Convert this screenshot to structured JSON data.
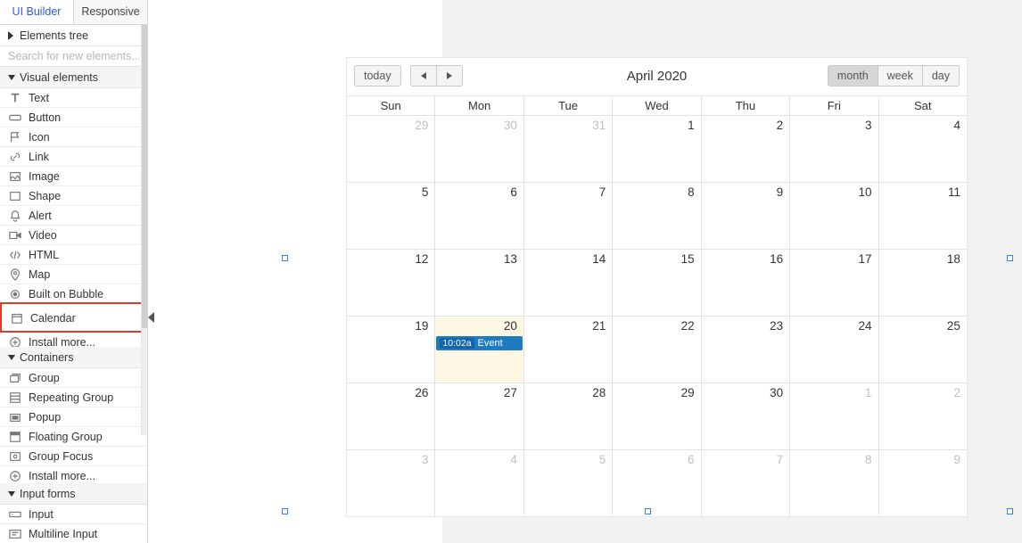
{
  "tabs": {
    "ui_builder": "UI Builder",
    "responsive": "Responsive"
  },
  "tree_header": "Elements tree",
  "search_placeholder": "Search for new elements...",
  "sections": {
    "visual": "Visual elements",
    "containers": "Containers",
    "input": "Input forms"
  },
  "visual_items": [
    {
      "icon": "text-icon",
      "label": "Text"
    },
    {
      "icon": "button-icon",
      "label": "Button"
    },
    {
      "icon": "flag-icon",
      "label": "Icon"
    },
    {
      "icon": "link-icon",
      "label": "Link"
    },
    {
      "icon": "image-icon",
      "label": "Image"
    },
    {
      "icon": "shape-icon",
      "label": "Shape"
    },
    {
      "icon": "bell-icon",
      "label": "Alert"
    },
    {
      "icon": "video-icon",
      "label": "Video"
    },
    {
      "icon": "html-icon",
      "label": "HTML"
    },
    {
      "icon": "map-icon",
      "label": "Map"
    },
    {
      "icon": "bubble-icon",
      "label": "Built on Bubble"
    },
    {
      "icon": "calendar-icon",
      "label": "Calendar",
      "highlight": true
    },
    {
      "icon": "plus-icon",
      "label": "Install more..."
    }
  ],
  "container_items": [
    {
      "icon": "group-icon",
      "label": "Group"
    },
    {
      "icon": "repeat-icon",
      "label": "Repeating Group"
    },
    {
      "icon": "popup-icon",
      "label": "Popup"
    },
    {
      "icon": "float-icon",
      "label": "Floating Group"
    },
    {
      "icon": "focus-icon",
      "label": "Group Focus"
    },
    {
      "icon": "plus-icon",
      "label": "Install more..."
    }
  ],
  "input_items": [
    {
      "icon": "input-icon",
      "label": "Input"
    },
    {
      "icon": "multi-icon",
      "label": "Multiline Input"
    }
  ],
  "calendar": {
    "today_btn": "today",
    "title": "April 2020",
    "views": {
      "month": "month",
      "week": "week",
      "day": "day"
    },
    "dow": [
      "Sun",
      "Mon",
      "Tue",
      "Wed",
      "Thu",
      "Fri",
      "Sat"
    ],
    "weeks": [
      [
        {
          "n": "29",
          "other": true
        },
        {
          "n": "30",
          "other": true
        },
        {
          "n": "31",
          "other": true
        },
        {
          "n": "1"
        },
        {
          "n": "2"
        },
        {
          "n": "3"
        },
        {
          "n": "4"
        }
      ],
      [
        {
          "n": "5"
        },
        {
          "n": "6"
        },
        {
          "n": "7"
        },
        {
          "n": "8"
        },
        {
          "n": "9"
        },
        {
          "n": "10"
        },
        {
          "n": "11"
        }
      ],
      [
        {
          "n": "12"
        },
        {
          "n": "13"
        },
        {
          "n": "14"
        },
        {
          "n": "15"
        },
        {
          "n": "16"
        },
        {
          "n": "17"
        },
        {
          "n": "18"
        }
      ],
      [
        {
          "n": "19"
        },
        {
          "n": "20",
          "today": true,
          "event": {
            "time": "10:02a",
            "title": "Event"
          }
        },
        {
          "n": "21"
        },
        {
          "n": "22"
        },
        {
          "n": "23"
        },
        {
          "n": "24"
        },
        {
          "n": "25"
        }
      ],
      [
        {
          "n": "26"
        },
        {
          "n": "27"
        },
        {
          "n": "28"
        },
        {
          "n": "29"
        },
        {
          "n": "30"
        },
        {
          "n": "1",
          "other": true
        },
        {
          "n": "2",
          "other": true
        }
      ],
      [
        {
          "n": "3",
          "other": true
        },
        {
          "n": "4",
          "other": true
        },
        {
          "n": "5",
          "other": true
        },
        {
          "n": "6",
          "other": true
        },
        {
          "n": "7",
          "other": true
        },
        {
          "n": "8",
          "other": true
        },
        {
          "n": "9",
          "other": true
        }
      ]
    ]
  }
}
